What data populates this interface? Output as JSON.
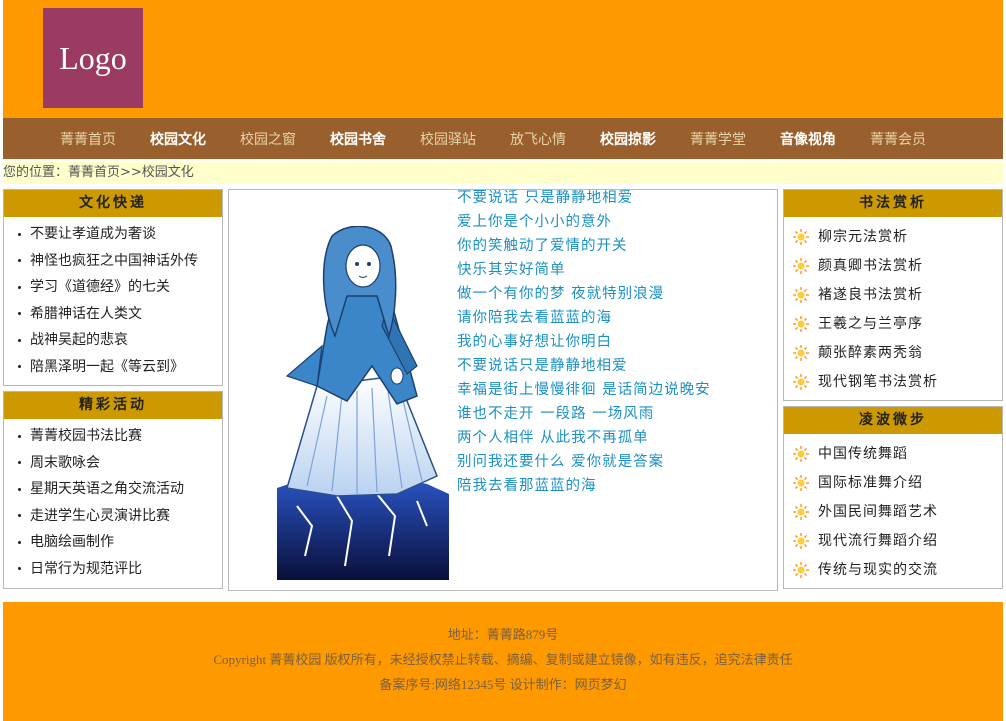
{
  "header": {
    "logo_text": "Logo"
  },
  "nav": [
    {
      "label": "菁菁首页",
      "bold": false
    },
    {
      "label": "校园文化",
      "bold": true
    },
    {
      "label": "校园之窗",
      "bold": false
    },
    {
      "label": "校园书舍",
      "bold": true
    },
    {
      "label": "校园驿站",
      "bold": false
    },
    {
      "label": "放飞心情",
      "bold": false
    },
    {
      "label": "校园掠影",
      "bold": true
    },
    {
      "label": "菁菁学堂",
      "bold": false
    },
    {
      "label": "音像视角",
      "bold": true
    },
    {
      "label": "菁菁会员",
      "bold": false
    }
  ],
  "breadcrumb": "您的位置：菁菁首页>>校园文化",
  "left": {
    "culture": {
      "title": "文化快递",
      "items": [
        "不要让孝道成为奢谈",
        "神怪也疯狂之中国神话外传",
        "学习《道德经》的七关",
        "希腊神话在人类文",
        "战神吴起的悲哀",
        "陪黑泽明一起《等云到》"
      ]
    },
    "activities": {
      "title": "精彩活动",
      "items": [
        "菁菁校园书法比赛",
        "周末歌咏会",
        "星期天英语之角交流活动",
        "走进学生心灵演讲比赛",
        "电脑绘画制作",
        "日常行为规范评比"
      ]
    }
  },
  "center": {
    "figure_icon": "girl-illustration",
    "poem": [
      "不要说话 只是静静地相爱",
      "爱上你是个小小的意外",
      "你的笑触动了爱情的开关",
      "快乐其实好简单",
      "做一个有你的梦 夜就特别浪漫",
      "请你陪我去看蓝蓝的海",
      "我的心事好想让你明白",
      "不要说话只是静静地相爱",
      "幸福是街上慢慢徘徊 是话简边说晚安",
      "谁也不走开 一段路 一场风雨",
      "两个人相伴 从此我不再孤单",
      "别问我还要什么 爱你就是答案",
      "陪我去看那蓝蓝的海"
    ]
  },
  "right": {
    "calligraphy": {
      "title": "书法赏析",
      "items": [
        "柳宗元法赏析",
        "颜真卿书法赏析",
        "褚遂良书法赏析",
        "王羲之与兰亭序",
        "颠张醉素两秃翁",
        "现代钢笔书法赏析"
      ]
    },
    "dance": {
      "title": "凌波微步",
      "items": [
        "中国传统舞蹈",
        "国际标准舞介绍",
        "外国民间舞蹈艺术",
        "现代流行舞蹈介绍",
        "传统与现实的交流"
      ]
    }
  },
  "footer": {
    "address": "地址：菁菁路879号",
    "copyright": "Copyright 菁菁校园 版权所有，未经授权禁止转载、摘编、复制或建立镜像，如有违反，追究法律责任",
    "icp": "备案序号:网络12345号 设计制作：网页梦幻"
  },
  "colors": {
    "header": "#ff9900",
    "nav": "#99602e",
    "panel_title": "#cc9900",
    "poem": "#1d90c2",
    "logo": "#9b3a63"
  }
}
